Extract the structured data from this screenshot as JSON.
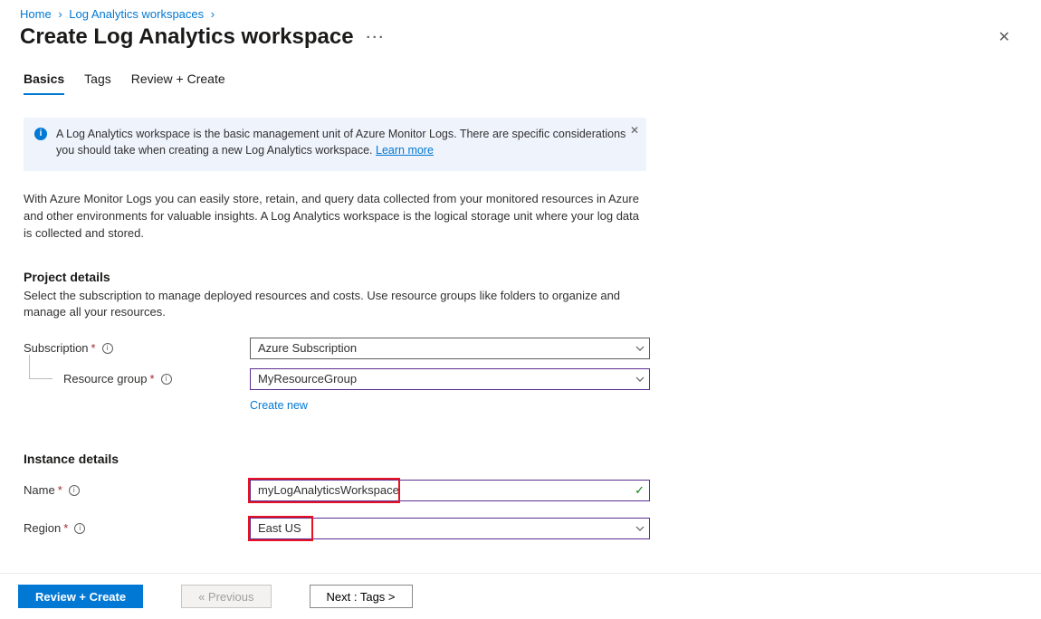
{
  "breadcrumb": {
    "home": "Home",
    "level1": "Log Analytics workspaces"
  },
  "header": {
    "title": "Create Log Analytics workspace"
  },
  "tabs": {
    "basics": "Basics",
    "tags": "Tags",
    "review": "Review + Create"
  },
  "banner": {
    "text": "A Log Analytics workspace is the basic management unit of Azure Monitor Logs. There are specific considerations you should take when creating a new Log Analytics workspace. ",
    "learn_more": "Learn more"
  },
  "intro": "With Azure Monitor Logs you can easily store, retain, and query data collected from your monitored resources in Azure and other environments for valuable insights. A Log Analytics workspace is the logical storage unit where your log data is collected and stored.",
  "project": {
    "title": "Project details",
    "sub": "Select the subscription to manage deployed resources and costs. Use resource groups like folders to organize and manage all your resources.",
    "subscription_label": "Subscription",
    "subscription_value": "Azure Subscription",
    "resource_group_label": "Resource group",
    "resource_group_value": "MyResourceGroup",
    "create_new": "Create new"
  },
  "instance": {
    "title": "Instance details",
    "name_label": "Name",
    "name_value": "myLogAnalyticsWorkspace",
    "region_label": "Region",
    "region_value": "East US"
  },
  "footer": {
    "review": "Review + Create",
    "previous": "« Previous",
    "next": "Next : Tags >"
  }
}
